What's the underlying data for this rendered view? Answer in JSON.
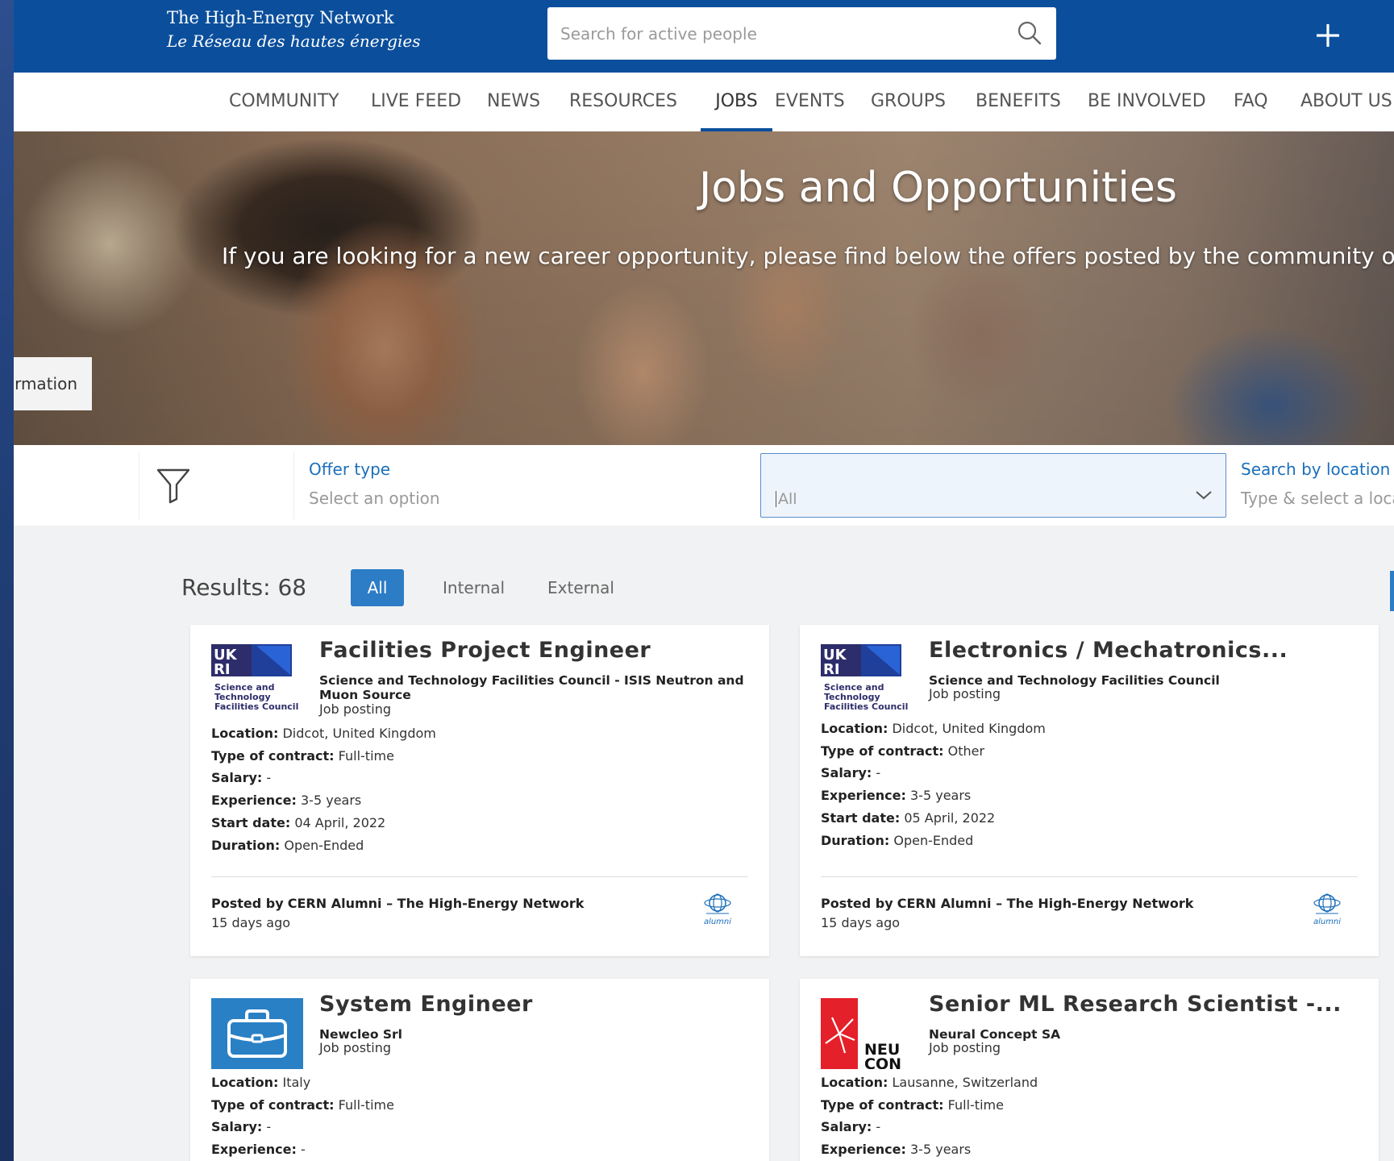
{
  "header": {
    "brand_line1": "The High-Energy Network",
    "brand_line2": "Le Réseau des hautes énergies",
    "search_placeholder": "Search for active people",
    "colors": {
      "bar": "#0b4f9c"
    }
  },
  "nav": {
    "items": [
      "COMMUNITY",
      "LIVE FEED",
      "NEWS",
      "RESOURCES",
      "JOBS",
      "EVENTS",
      "GROUPS",
      "BENEFITS",
      "BE INVOLVED",
      "FAQ",
      "ABOUT US"
    ],
    "active": "JOBS"
  },
  "hero": {
    "title": "Jobs and Opportunities",
    "subtitle": "If you are looking for a new career opportunity, please find below the offers posted by the community or s",
    "side_tab": "rmation"
  },
  "filters": {
    "offer_type_label": "Offer type",
    "offer_type_hint": "Select an option",
    "offer_type_value": "All",
    "location_label": "Search by location",
    "location_hint": "Type & select a loca"
  },
  "results": {
    "count_text": "Results: 68",
    "tabs": [
      "All",
      "Internal",
      "External"
    ],
    "active_tab": "All"
  },
  "cards": [
    {
      "title": "Facilities Project Engineer",
      "org": "Science and Technology Facilities Council - ISIS Neutron and Muon Source",
      "kind": "Job posting",
      "logo": "ukri-stfc-logo",
      "logo_caption": [
        "Science and",
        "Technology",
        "Facilities Council"
      ],
      "location_label": "Location:",
      "location": "Didcot, United Kingdom",
      "contract_label": "Type of contract:",
      "contract": "Full-time",
      "salary_label": "Salary:",
      "salary": "-",
      "experience_label": "Experience:",
      "experience": "3-5 years",
      "start_label": "Start date:",
      "start": "04 April, 2022",
      "duration_label": "Duration:",
      "duration": "Open-Ended",
      "posted_prefix": "Posted by",
      "posted_by": "CERN Alumni – The High-Energy Network",
      "ago": "15 days ago",
      "badge_word": "alumni"
    },
    {
      "title": "Electronics / Mechatronics...",
      "org": "Science and Technology Facilities Council",
      "kind": "Job posting",
      "logo": "ukri-stfc-logo",
      "logo_caption": [
        "Science and",
        "Technology",
        "Facilities Council"
      ],
      "location_label": "Location:",
      "location": "Didcot, United Kingdom",
      "contract_label": "Type of contract:",
      "contract": "Other",
      "salary_label": "Salary:",
      "salary": "-",
      "experience_label": "Experience:",
      "experience": "3-5 years",
      "start_label": "Start date:",
      "start": "05 April, 2022",
      "duration_label": "Duration:",
      "duration": "Open-Ended",
      "posted_prefix": "Posted by",
      "posted_by": "CERN Alumni – The High-Energy Network",
      "ago": "15 days ago",
      "badge_word": "alumni"
    },
    {
      "title": "System Engineer",
      "org": "Newcleo Srl",
      "kind": "Job posting",
      "logo": "briefcase-icon",
      "location_label": "Location:",
      "location": "Italy",
      "contract_label": "Type of contract:",
      "contract": "Full-time",
      "salary_label": "Salary:",
      "salary": "-",
      "experience_label": "Experience:",
      "experience": "-"
    },
    {
      "title": "Senior ML Research Scientist -...",
      "org": "Neural Concept SA",
      "kind": "Job posting",
      "logo": "neural-concept-logo",
      "logo_text": [
        "NEU",
        "CON"
      ],
      "location_label": "Location:",
      "location": "Lausanne, Switzerland",
      "contract_label": "Type of contract:",
      "contract": "Full-time",
      "salary_label": "Salary:",
      "salary": "-",
      "experience_label": "Experience:",
      "experience": "3-5 years"
    }
  ]
}
